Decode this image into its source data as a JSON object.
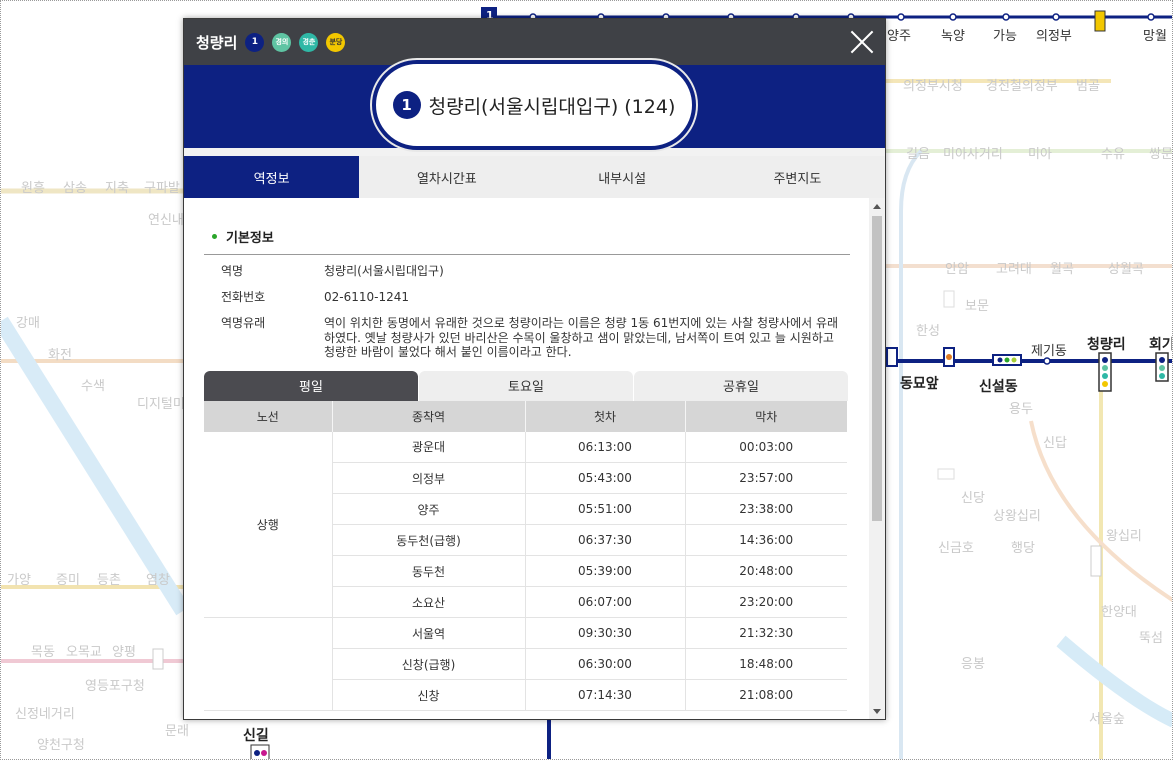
{
  "map": {
    "top_stations": [
      "양주",
      "녹양",
      "가능",
      "의정부",
      "망월"
    ],
    "faded_top": [
      "의정부시청",
      "경전철의정부",
      "범골"
    ],
    "faded_row2": [
      "길음",
      "미아사거리",
      "미아",
      "수유",
      "쌍문"
    ],
    "faded_left_top": [
      "원흥",
      "삼송",
      "지축",
      "구파발"
    ],
    "faded_yeonsin": "연신내",
    "faded_left": [
      "강매",
      "화전",
      "수색",
      "디지털미"
    ],
    "faded_mid_right": [
      "안암",
      "고려대",
      "월곡",
      "상월곡"
    ],
    "faded_bomun": "보문",
    "faded_hansin": "한성",
    "faded_right_col": [
      "용두",
      "신답"
    ],
    "faded_sindang": "신당",
    "faded_sangwang": "상왕십리",
    "faded_wangsimni": "왕십리",
    "faded_singeumho": "신금호",
    "faded_haengdang": "행당",
    "faded_left_mid": [
      "가양",
      "증미",
      "등촌",
      "염창"
    ],
    "faded_left_low": [
      "목동",
      "오목교",
      "양평"
    ],
    "faded_yeongdeungpo": "영등포구청",
    "faded_sinjeong": "신정네거리",
    "faded_yangcheon": "양천구청",
    "faded_mullae": "문래",
    "faded_haengdang2": "한양대",
    "faded_ttukseom": "뚝섬",
    "faded_eungbong": "응봉",
    "faded_seoulsup": "서울숲",
    "line_stations": {
      "dongmyo": "동묘앞",
      "sinseol": "신설동",
      "jegi": "제기동",
      "cheongnyangni": "청량리",
      "hoegi": "회기",
      "singil": "신길"
    }
  },
  "popup": {
    "title": "청량리",
    "badges": [
      {
        "label": "1",
        "color": "#0d2182"
      },
      {
        "label": "경의",
        "color": "#5fc4a3"
      },
      {
        "label": "경춘",
        "color": "#2fb8a6"
      },
      {
        "label": "분당",
        "color": "#f2c700"
      }
    ],
    "station_number_badge": "1",
    "station_name": "청량리(서울시립대입구) (124)",
    "tabs": [
      "역정보",
      "열차시간표",
      "내부시설",
      "주변지도"
    ],
    "section_title": "기본정보",
    "info": {
      "name_key": "역명",
      "name_val": "청량리(서울시립대입구)",
      "phone_key": "전화번호",
      "phone_val": "02-6110-1241",
      "origin_key": "역명유래",
      "origin_val": "역이 위치한 동명에서 유래한 것으로 청량이라는 이름은 청량 1동 61번지에 있는 사찰 청량사에서 유래하였다. 옛날 청량사가 있던 바리산은 수목이 울창하고 샘이 맑았는데, 남서쪽이 트여 있고 늘 시원하고 청량한 바람이 불었다 해서 붙인 이름이라고 한다."
    },
    "day_tabs": [
      "평일",
      "토요일",
      "공휴일"
    ],
    "table": {
      "headers": [
        "노선",
        "종착역",
        "첫차",
        "막차"
      ],
      "group1_label": "상행",
      "rows": [
        {
          "dest": "광운대",
          "first": "06:13:00",
          "last": "00:03:00"
        },
        {
          "dest": "의정부",
          "first": "05:43:00",
          "last": "23:57:00"
        },
        {
          "dest": "양주",
          "first": "05:51:00",
          "last": "23:38:00"
        },
        {
          "dest": "동두천(급행)",
          "first": "06:37:30",
          "last": "14:36:00"
        },
        {
          "dest": "동두천",
          "first": "05:39:00",
          "last": "20:48:00"
        },
        {
          "dest": "소요산",
          "first": "06:07:00",
          "last": "23:20:00"
        },
        {
          "dest": "서울역",
          "first": "09:30:30",
          "last": "21:32:30"
        },
        {
          "dest": "신창(급행)",
          "first": "06:30:00",
          "last": "18:48:00"
        },
        {
          "dest": "신창",
          "first": "07:14:30",
          "last": "21:08:00"
        }
      ]
    }
  }
}
